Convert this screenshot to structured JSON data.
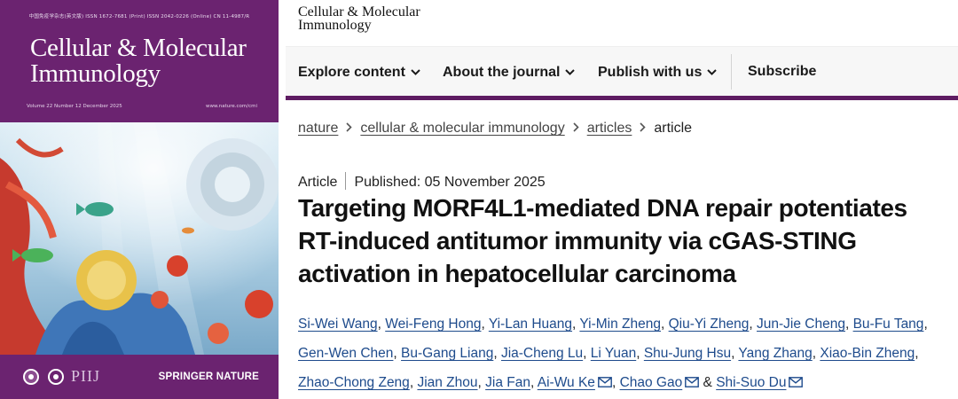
{
  "cover": {
    "topline": "中国免疫学杂志(英文版)   ISSN 1672-7681 (Print)   ISSN 2042-0226 (Online)   CN 11-4987/R",
    "title_line1": "Cellular & Molecular",
    "title_line2": "Immunology",
    "issue": "Volume 22  Number 12   December 2025",
    "url": "www.nature.com/cmi",
    "logo_text": "PIIJ",
    "publisher": "SPRINGER NATURE"
  },
  "site": {
    "brand_line1": "Cellular & Molecular",
    "brand_line2": "Immunology"
  },
  "nav": {
    "items": [
      {
        "label": "Explore content"
      },
      {
        "label": "About the journal"
      },
      {
        "label": "Publish with us"
      },
      {
        "label": "Subscribe"
      }
    ]
  },
  "breadcrumb": [
    "nature",
    "cellular & molecular immunology",
    "articles",
    "article"
  ],
  "article": {
    "type": "Article",
    "published": "Published: 05 November 2025",
    "title_lines": [
      "Targeting MORF4L1-mediated DNA repair potentiates",
      "RT-induced antitumor immunity via cGAS-STING",
      "activation in hepatocellular carcinoma"
    ]
  },
  "authors": [
    "Si-Wei Wang",
    "Wei-Feng Hong",
    "Yi-Lan Huang",
    "Yi-Min Zheng",
    "Qiu-Yi Zheng",
    "Jun-Jie Cheng",
    "Bu-Fu Tang",
    "Gen-Wen Chen",
    "Bu-Gang Liang",
    "Jia-Cheng Lu",
    "Li Yuan",
    "Shu-Jung Hsu",
    "Yang Zhang",
    "Xiao-Bin Zheng",
    "Zhao-Chong Zeng",
    "Jian Zhou",
    "Jia Fan",
    "Ai-Wu Ke",
    "Chao Gao",
    "Shi-Suo Du"
  ],
  "separators": {
    "comma": ",",
    "ampersand": "&"
  },
  "colors": {
    "cover_purple": "#6b2370",
    "accent_bar": "#5e1c62",
    "link": "#1e4b8c"
  },
  "icons": {
    "nav_dropdown": "chevron-down-icon",
    "crumb_sep": "chevron-right-icon",
    "corresponding": "mail-icon"
  }
}
